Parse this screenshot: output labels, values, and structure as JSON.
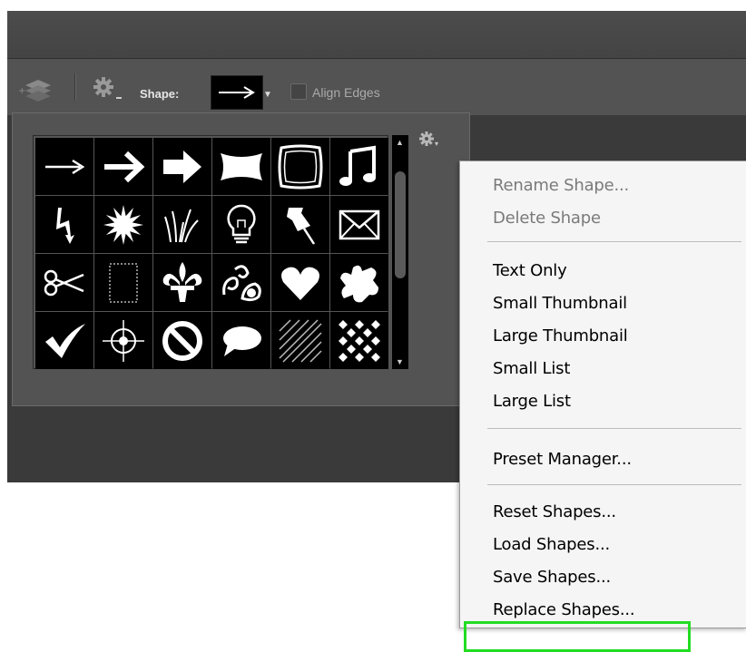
{
  "options_bar": {
    "shape_label": "Shape:",
    "align_edges_label": "Align Edges",
    "align_edges_checked": false,
    "icons": [
      "path-arrange-icon",
      "gear-icon",
      "arrow-shape-icon",
      "chevron-down-icon"
    ]
  },
  "picker": {
    "shapes": [
      "arrow-thin",
      "arrow-medium",
      "arrow-bold",
      "banner",
      "frame",
      "music-note",
      "lightning",
      "starburst",
      "grass",
      "light-bulb",
      "push-pin",
      "envelope",
      "scissors",
      "stamp-frame",
      "fleur-de-lis",
      "ornament",
      "heart",
      "puzzle-blob",
      "checkmark",
      "target",
      "no-sign",
      "speech-bubble",
      "hatch-pattern",
      "diamond-pattern"
    ]
  },
  "menu": {
    "items": [
      {
        "label": "Rename Shape...",
        "enabled": false
      },
      {
        "label": "Delete Shape",
        "enabled": false
      },
      {
        "label": "Text Only",
        "enabled": true
      },
      {
        "label": "Small Thumbnail",
        "enabled": true
      },
      {
        "label": "Large Thumbnail",
        "enabled": true
      },
      {
        "label": "Small List",
        "enabled": true
      },
      {
        "label": "Large List",
        "enabled": true
      },
      {
        "label": "Preset Manager...",
        "enabled": true
      },
      {
        "label": "Reset Shapes...",
        "enabled": true
      },
      {
        "label": "Load Shapes...",
        "enabled": true
      },
      {
        "label": "Save Shapes...",
        "enabled": true
      },
      {
        "label": "Replace Shapes...",
        "enabled": true
      }
    ],
    "highlighted_item": "Replace Shapes...",
    "highlight_color": "#22dd22"
  }
}
